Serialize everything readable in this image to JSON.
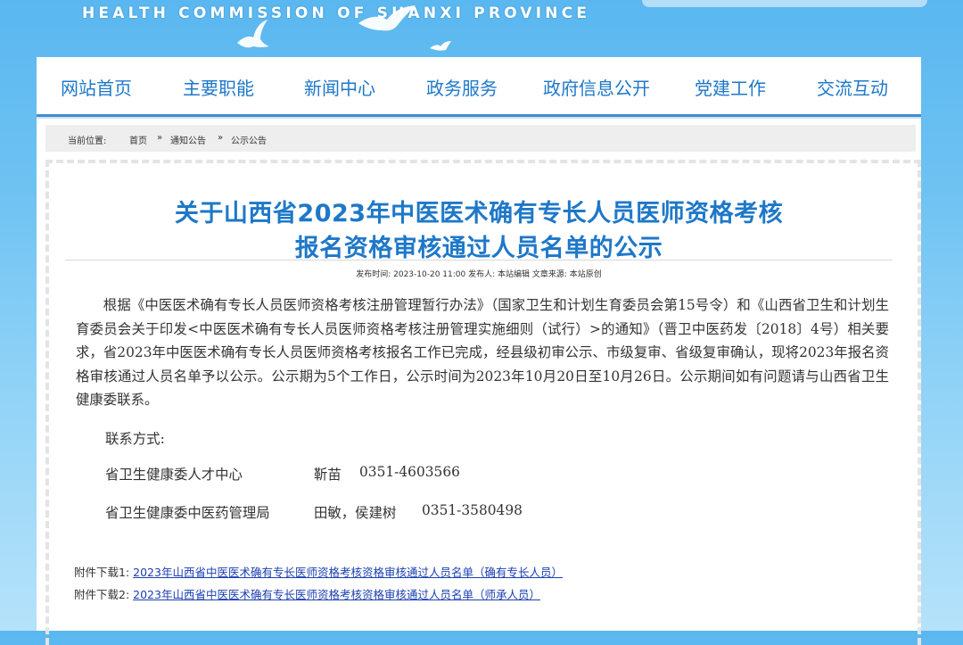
{
  "header": {
    "site_title_en": "HEALTH COMMISSION OF SHANXI PROVINCE"
  },
  "nav": {
    "items": [
      {
        "label": "网站首页"
      },
      {
        "label": "主要职能"
      },
      {
        "label": "新闻中心"
      },
      {
        "label": "政务服务"
      },
      {
        "label": "政府信息公开"
      },
      {
        "label": "党建工作"
      },
      {
        "label": "交流互动"
      }
    ]
  },
  "breadcrumb": {
    "prefix": "当前位置:",
    "items": [
      "首页",
      "通知公告",
      "公示公告"
    ],
    "separator": "»"
  },
  "article": {
    "title_line1": "关于山西省2023年中医医术确有专长人员医师资格考核",
    "title_line2": "报名资格审核通过人员名单的公示",
    "meta": "发布时间:  2023-10-20 11:00   发布人:  本站编辑   文章来源:  本站原创",
    "body": "根据《中医医术确有专长人员医师资格考核注册管理暂行办法》（国家卫生和计划生育委员会第15号令）和《山西省卫生和计划生育委员会关于印发<中医医术确有专长人员医师资格考核注册管理实施细则（试行）>的通知》（晋卫中医药发〔2018〕4号）相关要求，省2023年中医医术确有专长人员医师资格考核报名工作已完成，经县级初审公示、市级复审、省级复审确认，现将2023年报名资格审核通过人员名单予以公示。公示期为5个工作日，公示时间为2023年10月20日至10月26日。公示期间如有问题请与山西省卫生健康委联系。",
    "contact_heading": "联系方式:",
    "contacts": [
      {
        "org": "省卫生健康委人才中心",
        "person": "靳苗",
        "phone": "0351-4603566"
      },
      {
        "org": "省卫生健康委中医药管理局",
        "person": "田敏，侯建树",
        "phone": "0351-3580498"
      }
    ],
    "attachments": [
      {
        "label": "附件下载1:",
        "link": "2023年山西省中医医术确有专长医师资格考核资格审核通过人员名单（确有专长人员）"
      },
      {
        "label": "附件下载2:",
        "link": "2023年山西省中医医术确有专长医师资格考核资格审核通过人员名单（师承人员）"
      }
    ]
  },
  "colors": {
    "accent": "#1e78c8",
    "nav_border": "#3f8fd2",
    "link": "#1a3fb0",
    "sky": "#6ec2f2"
  }
}
